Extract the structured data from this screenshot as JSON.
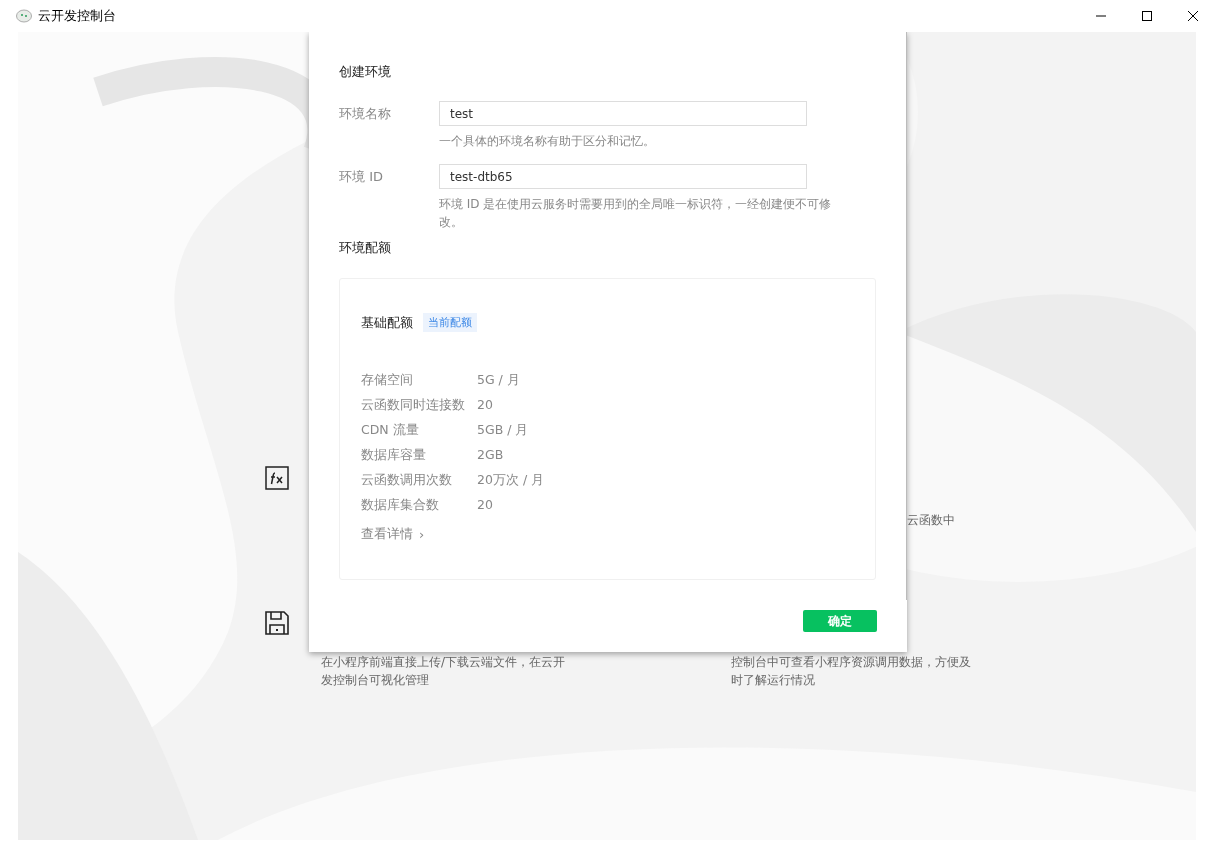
{
  "window": {
    "title": "云开发控制台"
  },
  "background": {
    "features": [
      {
        "right_lines": [
          "云函数中"
        ]
      },
      {
        "left_lines": [
          "在小程序前端直接上传/下载云端文件，在云开",
          "发控制台可视化管理"
        ],
        "right_lines": [
          "控制台中可查看小程序资源调用数据，方便及",
          "时了解运行情况"
        ]
      }
    ]
  },
  "dialog": {
    "title": "创建环境",
    "fields": [
      {
        "label": "环境名称",
        "value": "test",
        "hint": "一个具体的环境名称有助于区分和记忆。"
      },
      {
        "label": "环境 ID",
        "value": "test-dtb65",
        "hint": "环境 ID 是在使用云服务时需要用到的全局唯一标识符，一经创建便不可修改。"
      }
    ],
    "quota_heading": "环境配额",
    "quota": {
      "title": "基础配额",
      "badge": "当前配额",
      "rows": [
        {
          "label": "存储空间",
          "value": "5G / 月"
        },
        {
          "label": "云函数同时连接数",
          "value": "20"
        },
        {
          "label": "CDN 流量",
          "value": "5GB / 月"
        },
        {
          "label": "数据库容量",
          "value": "2GB"
        },
        {
          "label": "云函数调用次数",
          "value": "20万次 / 月"
        },
        {
          "label": "数据库集合数",
          "value": "20"
        }
      ],
      "details_link": "查看详情",
      "details_arrow": "›"
    },
    "confirm_button": "确定"
  }
}
